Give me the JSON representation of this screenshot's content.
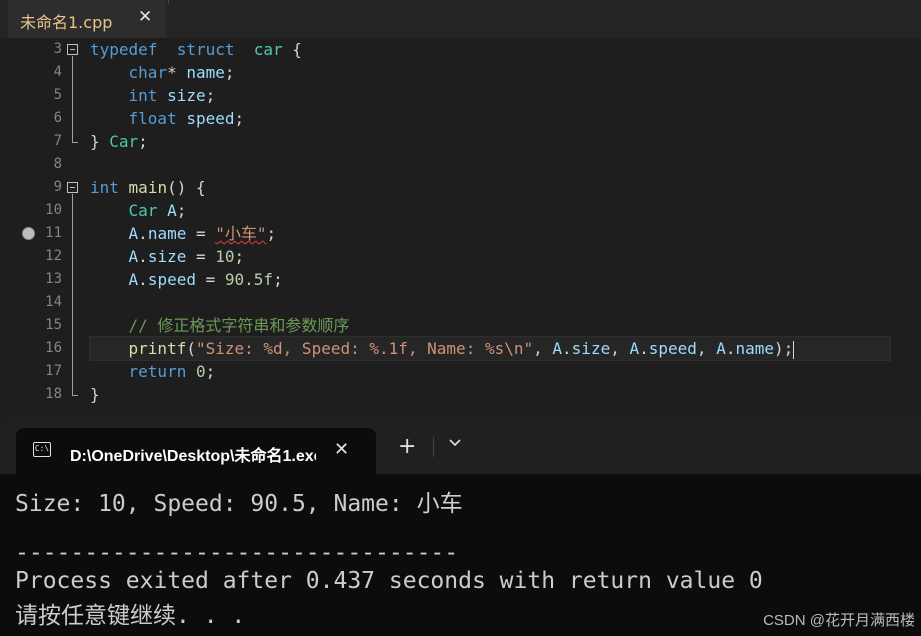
{
  "editor": {
    "tab": {
      "title": "未命名1.cpp",
      "close": "✕"
    },
    "lines": [
      {
        "num": "3",
        "tokens": [
          [
            "kw",
            "typedef"
          ],
          [
            "",
            "  "
          ],
          [
            "kw",
            "struct"
          ],
          [
            "",
            "  "
          ],
          [
            "ty",
            "car"
          ],
          [
            "",
            " {"
          ]
        ]
      },
      {
        "num": "4",
        "tokens": [
          [
            "",
            "    "
          ],
          [
            "kw",
            "char"
          ],
          [
            "",
            "* "
          ],
          [
            "id",
            "name"
          ],
          [
            "",
            ";"
          ]
        ]
      },
      {
        "num": "5",
        "tokens": [
          [
            "",
            "    "
          ],
          [
            "kw",
            "int"
          ],
          [
            "",
            " "
          ],
          [
            "id",
            "size"
          ],
          [
            "",
            ";"
          ]
        ]
      },
      {
        "num": "6",
        "tokens": [
          [
            "",
            "    "
          ],
          [
            "kw",
            "float"
          ],
          [
            "",
            " "
          ],
          [
            "id",
            "speed"
          ],
          [
            "",
            ";"
          ]
        ]
      },
      {
        "num": "7",
        "tokens": [
          [
            "",
            "} "
          ],
          [
            "ty",
            "Car"
          ],
          [
            "",
            ";"
          ]
        ]
      },
      {
        "num": "8",
        "tokens": []
      },
      {
        "num": "9",
        "tokens": [
          [
            "kw",
            "int"
          ],
          [
            "",
            " "
          ],
          [
            "fn",
            "main"
          ],
          [
            "",
            "() {"
          ]
        ]
      },
      {
        "num": "10",
        "tokens": [
          [
            "",
            "    "
          ],
          [
            "ty",
            "Car"
          ],
          [
            "",
            " "
          ],
          [
            "id",
            "A"
          ],
          [
            "",
            ";"
          ]
        ]
      },
      {
        "num": "11",
        "tokens": [
          [
            "",
            "    "
          ],
          [
            "id",
            "A"
          ],
          [
            "",
            "."
          ],
          [
            "id",
            "name"
          ],
          [
            "",
            " = "
          ],
          [
            "str squig",
            "\"小车\""
          ],
          [
            "",
            ";"
          ]
        ]
      },
      {
        "num": "12",
        "tokens": [
          [
            "",
            "    "
          ],
          [
            "id",
            "A"
          ],
          [
            "",
            "."
          ],
          [
            "id",
            "size"
          ],
          [
            "",
            " = "
          ],
          [
            "num",
            "10"
          ],
          [
            "",
            ";"
          ]
        ]
      },
      {
        "num": "13",
        "tokens": [
          [
            "",
            "    "
          ],
          [
            "id",
            "A"
          ],
          [
            "",
            "."
          ],
          [
            "id",
            "speed"
          ],
          [
            "",
            " = "
          ],
          [
            "num",
            "90.5f"
          ],
          [
            "",
            ";"
          ]
        ]
      },
      {
        "num": "14",
        "tokens": []
      },
      {
        "num": "15",
        "tokens": [
          [
            "",
            "    "
          ],
          [
            "cm",
            "// 修正格式字符串和参数顺序"
          ]
        ]
      },
      {
        "num": "16",
        "tokens": [
          [
            "",
            "    "
          ],
          [
            "fn",
            "printf"
          ],
          [
            "",
            "("
          ],
          [
            "str",
            "\"Size: %d, Speed: %.1f, Name: %s\\n\""
          ],
          [
            "",
            ", "
          ],
          [
            "id",
            "A"
          ],
          [
            "",
            "."
          ],
          [
            "id",
            "size"
          ],
          [
            "",
            ", "
          ],
          [
            "id",
            "A"
          ],
          [
            "",
            "."
          ],
          [
            "id",
            "speed"
          ],
          [
            "",
            ", "
          ],
          [
            "id",
            "A"
          ],
          [
            "",
            "."
          ],
          [
            "id",
            "name"
          ],
          [
            "",
            ");"
          ]
        ]
      },
      {
        "num": "17",
        "tokens": [
          [
            "",
            "    "
          ],
          [
            "kw",
            "return"
          ],
          [
            "",
            " "
          ],
          [
            "num",
            "0"
          ],
          [
            "",
            ";"
          ]
        ]
      },
      {
        "num": "18",
        "tokens": [
          [
            "",
            "}"
          ]
        ]
      }
    ]
  },
  "terminal": {
    "tab_title": "D:\\OneDrive\\Desktop\\未命名1.exe",
    "tab_icon_glyph": "C:\\",
    "close": "✕",
    "new_tab": "+",
    "output": [
      "Size: 10, Speed: 90.5, Name: 小车",
      "",
      "--------------------------------",
      "Process exited after 0.437 seconds with return value 0",
      "请按任意键继续. . ."
    ]
  },
  "watermark": "CSDN @花开月满西楼",
  "colors": {
    "keyword": "#569cd6",
    "type": "#4ec9b0",
    "identifier": "#9cdcfe",
    "number": "#b5cea8",
    "string": "#ce9178",
    "comment": "#6a9955",
    "function": "#dcdcaa"
  }
}
